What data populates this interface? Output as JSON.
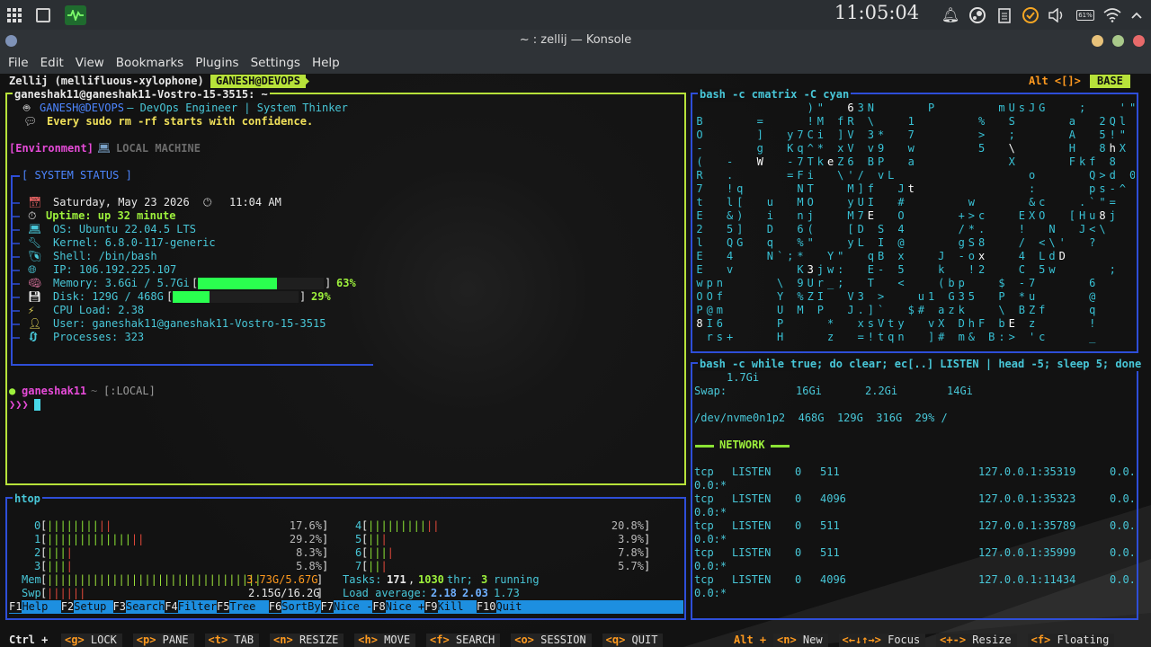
{
  "panel": {
    "clock": "11:05:04",
    "battery": "61%",
    "icons": [
      "apps-grid-icon",
      "window-icon",
      "system-monitor-icon",
      "bell-icon",
      "steam-icon",
      "clipboard-icon",
      "update-icon",
      "volume-icon",
      "battery-icon",
      "wifi-icon",
      "chevron-up-icon"
    ]
  },
  "window": {
    "title": "~ : zellij — Konsole"
  },
  "menubar": [
    "File",
    "Edit",
    "View",
    "Bookmarks",
    "Plugins",
    "Settings",
    "Help"
  ],
  "zellij": {
    "session": "Zellij (mellifluous-xylophone)",
    "tab": "GANESH@DEVOPS",
    "mode_hint": "Alt <[]>",
    "mode": "BASE",
    "bottom_left_mod": "Ctrl +",
    "bottom_left": [
      {
        "key": "<g>",
        "label": "LOCK"
      },
      {
        "key": "<p>",
        "label": "PANE"
      },
      {
        "key": "<t>",
        "label": "TAB"
      },
      {
        "key": "<n>",
        "label": "RESIZE"
      },
      {
        "key": "<h>",
        "label": "MOVE"
      },
      {
        "key": "<f>",
        "label": "SEARCH"
      },
      {
        "key": "<o>",
        "label": "SESSION"
      },
      {
        "key": "<q>",
        "label": "QUIT"
      }
    ],
    "bottom_right_mod": "Alt +",
    "bottom_right": [
      {
        "key": "<n>",
        "label": "New"
      },
      {
        "key": "<←↓↑→>",
        "label": "Focus"
      },
      {
        "key": "<+->",
        "label": "Resize"
      },
      {
        "key": "<f>",
        "label": "Floating"
      }
    ]
  },
  "shell": {
    "title": "ganeshak11@ganeshak11-Vostro-15-3515: ~",
    "banner_name": "GANESH@DEVOPS",
    "banner_role": " — DevOps Engineer | System Thinker",
    "banner_quote": "Every sudo rm -rf starts with confidence.",
    "env_label": "[Environment]",
    "env_value": "LOCAL MACHINE",
    "status_title": "[ SYSTEM STATUS ]",
    "date": "Saturday, May 23 2026",
    "time": "11:04 AM",
    "uptime": "Uptime: up 32 minute",
    "os": "OS: Ubuntu 22.04.5 LTS",
    "kernel": "Kernel: 6.8.0-117-generic",
    "shellpath": "Shell: /bin/bash",
    "ip": "IP: 106.192.225.107",
    "memory_label": "Memory: 3.6Gi / 5.7Gi",
    "memory_pct": "63%",
    "memory_fraction": 0.63,
    "disk_label": "Disk: 129G / 468G",
    "disk_pct": "29%",
    "disk_fraction": 0.29,
    "cpu": "CPU Load: 2.38",
    "user": "User: ganeshak11@ganeshak11-Vostro-15-3515",
    "processes": "Processes: 323",
    "prompt_user": "ganeshak11",
    "prompt_path": "~",
    "prompt_tag": "[:LOCAL]",
    "prompt_arrows": "❯❯❯"
  },
  "matrix": {
    "title": "bash -c cmatrix -C cyan",
    "rows": [
      "           )\"  63N     P      mUsJG   ;   '\"",
      "B     =    !M fR \\   1      %  S     a  2Ql",
      "O     ]  y7Ci ]V 3*  7      >  ;     A  5!\"",
      "-     g  Kq^* xV v9  w      5  \\     H  8hX",
      "(  -  W  -7TkeZ6 BP  a         X     Fkf 8",
      "R  .     =Fi  \\'/ vL             o     Q>d 0",
      "7  !q     NT   M]f  Jt           :     ps-^",
      "t  l[  u  MO   yUI  #      w     &c   .`\"=",
      "E  &)  i  nj   M7E  O     +>c   EXO  [Hu8j",
      "2  5]  D  6(   [D S 4     /*.   !  N  J<\\",
      "l  QG  q  %\"   yL I @     gS8   / <\\'  ?",
      "E  4   N`;*  Y\"  qB x   J -ox   4 LdD",
      "E  v      K3jw:  E- 5   k  !2   C 5w     ;",
      "wpn     \\ 9Ur_;  T  <   (bp   $ -7     6",
      "OOf     Y %ZI  V3 >   u1 G35  P *u     @",
      "P@m     U M P  J.]`  $# azk   \\ BZf    q",
      "8I6     P    *  xsVty  vX DhF bE z     !",
      " rs+    H    z  =!tqn  ]# m& B:> 'c    _"
    ],
    "highlights": [
      [
        0,
        15
      ],
      [
        3,
        41
      ],
      [
        4,
        6
      ],
      [
        4,
        13
      ],
      [
        4,
        22
      ],
      [
        5,
        12
      ],
      [
        5,
        42
      ],
      [
        6,
        21
      ],
      [
        8,
        17
      ],
      [
        8,
        35
      ],
      [
        8,
        40
      ],
      [
        10,
        5
      ],
      [
        11,
        36
      ],
      [
        12,
        11
      ],
      [
        14,
        13
      ],
      [
        15,
        11
      ],
      [
        15,
        37
      ],
      [
        16,
        0
      ],
      [
        16,
        31
      ],
      [
        11,
        28
      ],
      [
        3,
        31
      ],
      [
        2,
        38
      ]
    ]
  },
  "listen": {
    "title": "bash -c while true; do clear; ec[..] LISTEN | head -5; sleep 5; done",
    "mem_tail": "1.7Gi",
    "swap_label": "Swap:",
    "swap_total": "16Gi",
    "swap_used": "2.2Gi",
    "swap_free": "14Gi",
    "disk_line": "/dev/nvme0n1p2  468G  129G  316G  29% /",
    "network_heading": "NETWORK",
    "rows": [
      {
        "proto": "tcp",
        "state": "LISTEN",
        "recv": "0",
        "send": "511",
        "addr": "127.0.0.1:35319",
        "peer": "0.0.0.0:*"
      },
      {
        "proto": "tcp",
        "state": "LISTEN",
        "recv": "0",
        "send": "4096",
        "addr": "127.0.0.1:35323",
        "peer": "0.0.0.0:*"
      },
      {
        "proto": "tcp",
        "state": "LISTEN",
        "recv": "0",
        "send": "511",
        "addr": "127.0.0.1:35789",
        "peer": "0.0.0.0:*"
      },
      {
        "proto": "tcp",
        "state": "LISTEN",
        "recv": "0",
        "send": "511",
        "addr": "127.0.0.1:35999",
        "peer": "0.0.0.0:*"
      },
      {
        "proto": "tcp",
        "state": "LISTEN",
        "recv": "0",
        "send": "4096",
        "addr": "127.0.0.1:11434",
        "peer": "0.0.0.0:*"
      }
    ]
  },
  "htop": {
    "title": "htop",
    "cpus": [
      {
        "id": "0",
        "bar": "||||||||",
        "red": "||",
        "pct": "17.6%"
      },
      {
        "id": "1",
        "bar": "|||||||||||||",
        "red": "||",
        "pct": "29.2%"
      },
      {
        "id": "2",
        "bar": "|||",
        "red": "|",
        "pct": "8.3%"
      },
      {
        "id": "3",
        "bar": "|||",
        "red": "|",
        "pct": "5.8%"
      },
      {
        "id": "4",
        "bar": "|||||||||",
        "red": "||",
        "pct": "20.8%"
      },
      {
        "id": "5",
        "bar": "||",
        "red": "|",
        "pct": "3.9%"
      },
      {
        "id": "6",
        "bar": "|||",
        "red": "|",
        "pct": "7.8%"
      },
      {
        "id": "7",
        "bar": "||",
        "red": "|",
        "pct": "5.7%"
      }
    ],
    "mem_label": "Mem",
    "mem_bar": "|||||||||||||||||||||||||||||||||",
    "mem_val": "3.73G/5.67G",
    "swp_label": "Swp",
    "swp_bar": "||||||",
    "swp_val": "2.15G/16.2G",
    "tasks_label": "Tasks:",
    "tasks": "171",
    "thr": "1030",
    "thr_label": "thr;",
    "running": "3",
    "running_label": "running",
    "load_label": "Load average:",
    "load1": "2.18",
    "load5": "2.03",
    "load15": "1.73",
    "fkeys": [
      {
        "k": "F1",
        "l": "Help  "
      },
      {
        "k": "F2",
        "l": "Setup "
      },
      {
        "k": "F3",
        "l": "Search"
      },
      {
        "k": "F4",
        "l": "Filter"
      },
      {
        "k": "F5",
        "l": "Tree  "
      },
      {
        "k": "F6",
        "l": "SortBy"
      },
      {
        "k": "F7",
        "l": "Nice -"
      },
      {
        "k": "F8",
        "l": "Nice +"
      },
      {
        "k": "F9",
        "l": "Kill  "
      },
      {
        "k": "F10",
        "l": "Quit"
      }
    ]
  },
  "colors": {
    "active_border": "#b7e23a",
    "inactive_border": "#2e4ed8",
    "matrix": "#38c2d6",
    "accent_orange": "#ff9a1f"
  }
}
